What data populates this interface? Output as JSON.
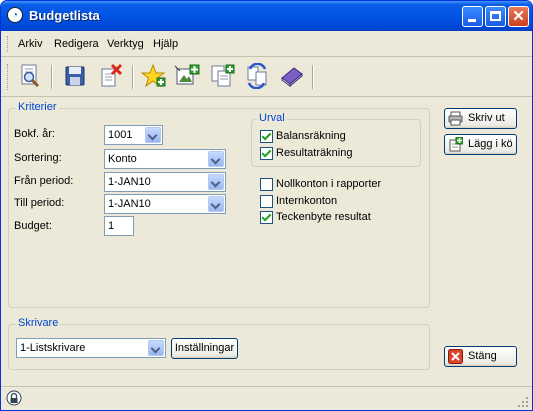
{
  "window": {
    "title": "Budgetlista"
  },
  "menu": {
    "items": [
      {
        "label": "Arkiv"
      },
      {
        "label": "Redigera"
      },
      {
        "label": "Verktyg"
      },
      {
        "label": "Hjälp"
      }
    ]
  },
  "toolbar": {
    "icons": [
      "preview-icon",
      "save-icon",
      "delete-icon",
      "new-star-icon",
      "add-picture-icon",
      "copy-icon",
      "refresh-icon",
      "book-icon"
    ]
  },
  "kriterier": {
    "legend": "Kriterier",
    "bokf_ar": {
      "label": "Bokf. år:",
      "value": "1001"
    },
    "sortering": {
      "label": "Sortering:",
      "value": "Konto"
    },
    "fran_period": {
      "label": "Från period:",
      "value": "1-JAN10"
    },
    "till_period": {
      "label": "Till period:",
      "value": "1-JAN10"
    },
    "budget": {
      "label": "Budget:",
      "value": "1"
    }
  },
  "urval": {
    "legend": "Urval",
    "balansrakning": {
      "label": "Balansräkning",
      "checked": true
    },
    "resultatrakning": {
      "label": "Resultaträkning",
      "checked": true
    }
  },
  "options": {
    "nollkonton": {
      "label": "Nollkonton i rapporter",
      "checked": false
    },
    "internkonton": {
      "label": "Internkonton",
      "checked": false
    },
    "teckenbyte": {
      "label": "Teckenbyte resultat",
      "checked": true
    }
  },
  "skrivare": {
    "legend": "Skrivare",
    "printer": "1-Listskrivare",
    "settings_label": "Inställningar"
  },
  "buttons": {
    "print_label": "Skriv ut",
    "queue_label": "Lägg i kö",
    "close_label": "Stäng"
  },
  "colors": {
    "accent": "#0054e3",
    "legend": "#0046d5",
    "close": "#c9401d"
  }
}
